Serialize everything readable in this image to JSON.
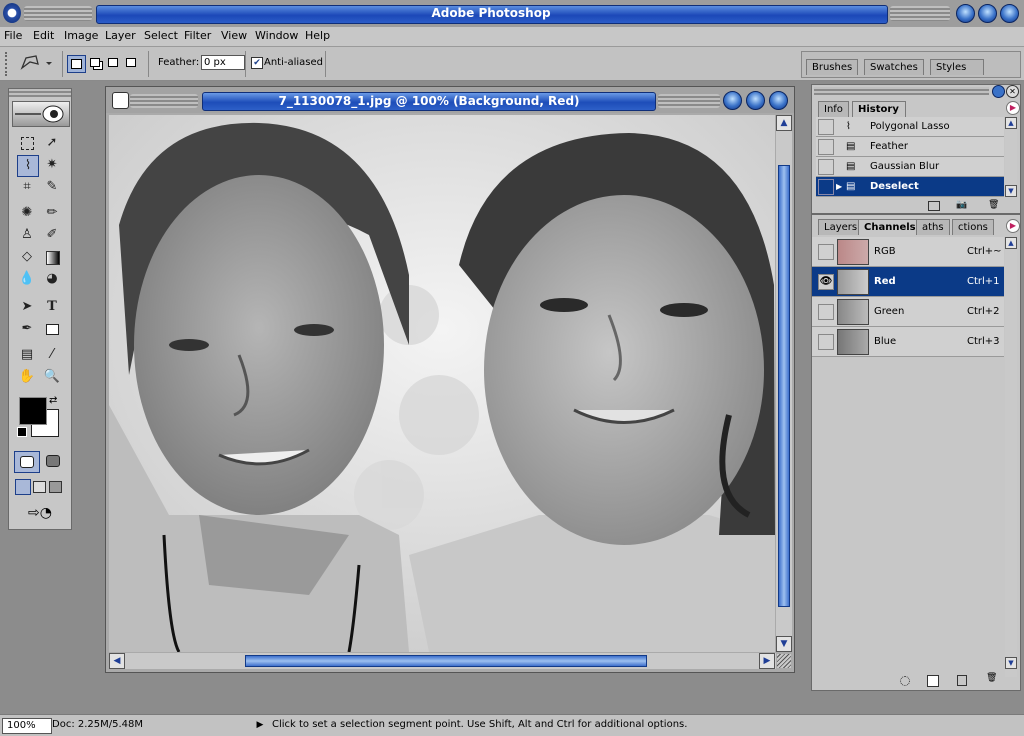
{
  "app": {
    "title": "Adobe Photoshop"
  },
  "menu": [
    "File",
    "Edit",
    "Image",
    "Layer",
    "Select",
    "Filter",
    "View",
    "Window",
    "Help"
  ],
  "options": {
    "feather_label": "Feather:",
    "feather_value": "0 px",
    "antialiased_label": "Anti-aliased",
    "antialiased_checked": true
  },
  "palette_well": {
    "tabs": [
      "Brushes",
      "Swatches",
      "Styles"
    ]
  },
  "document": {
    "title": "7_1130078_1.jpg @ 100% (Background, Red)"
  },
  "history_panel": {
    "tabs": [
      "Info",
      "History"
    ],
    "active_tab": "History",
    "items": [
      {
        "label": "Polygonal Lasso",
        "icon": "lasso-icon"
      },
      {
        "label": "Feather",
        "icon": "history-state-icon"
      },
      {
        "label": "Gaussian Blur",
        "icon": "history-state-icon"
      },
      {
        "label": "Deselect",
        "icon": "history-state-icon",
        "selected": true
      }
    ]
  },
  "channels_panel": {
    "tabs": [
      "Layers",
      "Channels",
      "Paths",
      "Actions"
    ],
    "tab_visible_text": [
      "Layers",
      "Channels",
      "aths",
      "ctions"
    ],
    "active_tab": "Channels",
    "channels": [
      {
        "name": "RGB",
        "shortcut": "Ctrl+~",
        "visible": false
      },
      {
        "name": "Red",
        "shortcut": "Ctrl+1",
        "visible": true,
        "selected": true
      },
      {
        "name": "Green",
        "shortcut": "Ctrl+2",
        "visible": false
      },
      {
        "name": "Blue",
        "shortcut": "Ctrl+3",
        "visible": false
      }
    ]
  },
  "status": {
    "zoom": "100%",
    "doc_size": "Doc: 2.25M/5.48M",
    "hint": "Click to set a selection segment point.  Use Shift, Alt and Ctrl for additional options."
  },
  "colors": {
    "accent": "#1d4db9",
    "selection": "#0b3a87",
    "chrome": "#c7c7c7"
  }
}
